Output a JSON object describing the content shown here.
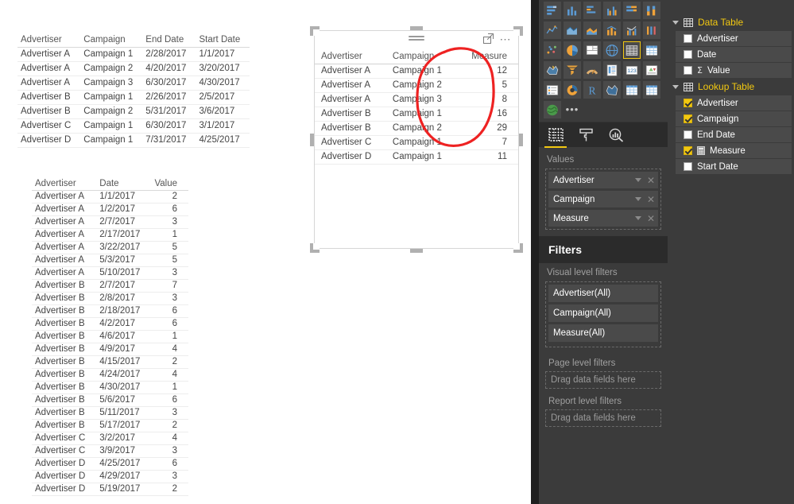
{
  "canvas": {
    "lookup_table": {
      "name": "lookup-data-preview",
      "columns": [
        "Advertiser",
        "Campaign",
        "End Date",
        "Start Date"
      ],
      "rows": [
        [
          "Advertiser A",
          "Campaign 1",
          "2/28/2017",
          "1/1/2017"
        ],
        [
          "Advertiser A",
          "Campaign 2",
          "4/20/2017",
          "3/20/2017"
        ],
        [
          "Advertiser A",
          "Campaign 3",
          "6/30/2017",
          "4/30/2017"
        ],
        [
          "Advertiser B",
          "Campaign 1",
          "2/26/2017",
          "2/5/2017"
        ],
        [
          "Advertiser B",
          "Campaign 2",
          "5/31/2017",
          "3/6/2017"
        ],
        [
          "Advertiser C",
          "Campaign 1",
          "6/30/2017",
          "3/1/2017"
        ],
        [
          "Advertiser D",
          "Campaign 1",
          "7/31/2017",
          "4/25/2017"
        ]
      ]
    },
    "data_table": {
      "name": "data-table-preview",
      "columns": [
        "Advertiser",
        "Date",
        "Value"
      ],
      "rows": [
        [
          "Advertiser A",
          "1/1/2017",
          "2"
        ],
        [
          "Advertiser A",
          "1/2/2017",
          "6"
        ],
        [
          "Advertiser A",
          "2/7/2017",
          "3"
        ],
        [
          "Advertiser A",
          "2/17/2017",
          "1"
        ],
        [
          "Advertiser A",
          "3/22/2017",
          "5"
        ],
        [
          "Advertiser A",
          "5/3/2017",
          "5"
        ],
        [
          "Advertiser A",
          "5/10/2017",
          "3"
        ],
        [
          "Advertiser B",
          "2/7/2017",
          "7"
        ],
        [
          "Advertiser B",
          "2/8/2017",
          "3"
        ],
        [
          "Advertiser B",
          "2/18/2017",
          "6"
        ],
        [
          "Advertiser B",
          "4/2/2017",
          "6"
        ],
        [
          "Advertiser B",
          "4/6/2017",
          "1"
        ],
        [
          "Advertiser B",
          "4/9/2017",
          "4"
        ],
        [
          "Advertiser B",
          "4/15/2017",
          "2"
        ],
        [
          "Advertiser B",
          "4/24/2017",
          "4"
        ],
        [
          "Advertiser B",
          "4/30/2017",
          "1"
        ],
        [
          "Advertiser B",
          "5/6/2017",
          "6"
        ],
        [
          "Advertiser B",
          "5/11/2017",
          "3"
        ],
        [
          "Advertiser B",
          "5/17/2017",
          "2"
        ],
        [
          "Advertiser C",
          "3/2/2017",
          "4"
        ],
        [
          "Advertiser C",
          "3/9/2017",
          "3"
        ],
        [
          "Advertiser D",
          "4/25/2017",
          "6"
        ],
        [
          "Advertiser D",
          "4/29/2017",
          "3"
        ],
        [
          "Advertiser D",
          "5/19/2017",
          "2"
        ]
      ]
    },
    "visual": {
      "name": "table-visual",
      "columns": [
        "Advertiser",
        "Campaign",
        "Measure"
      ],
      "rows": [
        [
          "Advertiser A",
          "Campaign 1",
          "12"
        ],
        [
          "Advertiser A",
          "Campaign 2",
          "5"
        ],
        [
          "Advertiser A",
          "Campaign 3",
          "8"
        ],
        [
          "Advertiser B",
          "Campaign 1",
          "16"
        ],
        [
          "Advertiser B",
          "Campaign 2",
          "29"
        ],
        [
          "Advertiser C",
          "Campaign 1",
          "7"
        ],
        [
          "Advertiser D",
          "Campaign 1",
          "11"
        ]
      ],
      "header_icons": [
        "sort-menu-icon",
        "focus-mode-icon",
        "more-options-icon"
      ]
    },
    "annotation": {
      "name": "red-ellipse-annotation",
      "color": "#ee2222"
    }
  },
  "visualizations": {
    "gallery": [
      {
        "name": "stacked-bar-chart-icon"
      },
      {
        "name": "stacked-column-chart-icon"
      },
      {
        "name": "clustered-bar-chart-icon"
      },
      {
        "name": "clustered-column-chart-icon"
      },
      {
        "name": "hundred-percent-stacked-bar-icon"
      },
      {
        "name": "hundred-percent-stacked-column-icon"
      },
      {
        "name": "line-chart-icon"
      },
      {
        "name": "area-chart-icon"
      },
      {
        "name": "stacked-area-chart-icon"
      },
      {
        "name": "line-stacked-column-icon"
      },
      {
        "name": "line-clustered-column-icon"
      },
      {
        "name": "ribbon-chart-icon"
      },
      {
        "name": "scatter-chart-icon"
      },
      {
        "name": "pie-chart-icon"
      },
      {
        "name": "treemap-icon"
      },
      {
        "name": "map-icon"
      },
      {
        "name": "table-icon",
        "selected": true
      },
      {
        "name": "matrix-icon"
      },
      {
        "name": "filled-map-icon"
      },
      {
        "name": "funnel-icon"
      },
      {
        "name": "gauge-icon"
      },
      {
        "name": "multi-row-card-icon"
      },
      {
        "name": "card-icon"
      },
      {
        "name": "kpi-icon"
      },
      {
        "name": "slicer-icon"
      },
      {
        "name": "donut-chart-icon"
      },
      {
        "name": "r-script-visual-icon"
      },
      {
        "name": "shape-map-icon"
      },
      {
        "name": "matrix-2-icon"
      },
      {
        "name": "table-2-icon"
      },
      {
        "name": "arcgis-map-icon"
      },
      {
        "name": "more-visuals-icon"
      }
    ],
    "tabs": [
      {
        "name": "fields-tab",
        "icon": "fields-grid-icon",
        "active": true
      },
      {
        "name": "format-tab",
        "icon": "paint-roller-icon",
        "active": false
      },
      {
        "name": "analytics-tab",
        "icon": "magnifier-chart-icon",
        "active": false
      }
    ],
    "values_label": "Values",
    "values": [
      {
        "label": "Advertiser"
      },
      {
        "label": "Campaign"
      },
      {
        "label": "Measure"
      }
    ]
  },
  "filters": {
    "title": "Filters",
    "visual_level_label": "Visual level filters",
    "visual_level_filters": [
      {
        "label": "Advertiser(All)"
      },
      {
        "label": "Campaign(All)"
      },
      {
        "label": "Measure(All)"
      }
    ],
    "page_level_label": "Page level filters",
    "page_level_placeholder": "Drag data fields here",
    "report_level_label": "Report level filters",
    "report_level_placeholder": "Drag data fields here"
  },
  "fields": {
    "tables": [
      {
        "name": "Data Table",
        "fields": [
          {
            "label": "Advertiser",
            "checked": false,
            "measure": false,
            "aggregate": false
          },
          {
            "label": "Date",
            "checked": false,
            "measure": false,
            "aggregate": false
          },
          {
            "label": "Value",
            "checked": false,
            "measure": false,
            "aggregate": true
          }
        ]
      },
      {
        "name": "Lookup Table",
        "fields": [
          {
            "label": "Advertiser",
            "checked": true,
            "measure": false,
            "aggregate": false
          },
          {
            "label": "Campaign",
            "checked": true,
            "measure": false,
            "aggregate": false
          },
          {
            "label": "End Date",
            "checked": false,
            "measure": false,
            "aggregate": false
          },
          {
            "label": "Measure",
            "checked": true,
            "measure": true,
            "aggregate": false
          },
          {
            "label": "Start Date",
            "checked": false,
            "measure": false,
            "aggregate": false
          }
        ]
      }
    ]
  },
  "colors": {
    "accent": "#f2c811",
    "pane_bg": "#3b3b3b",
    "pane_dark": "#2b2b2b",
    "annotation": "#ee2222"
  }
}
